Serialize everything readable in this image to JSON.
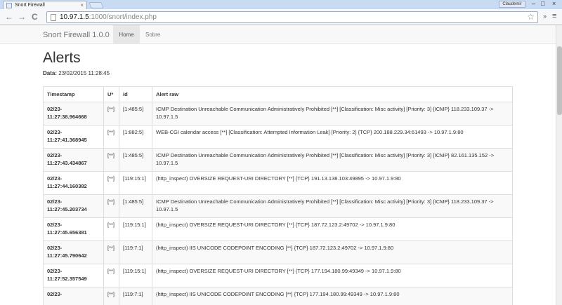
{
  "browser": {
    "tab_title": "Snort Firewall",
    "tab_close": "×",
    "user_label": "Claudemir",
    "win_minimize": "–",
    "win_maximize": "□",
    "win_close": "×",
    "url_host": "10.97.1.5",
    "url_rest": ":1000/snort/index.php",
    "back_icon": "←",
    "forward_icon": "→",
    "reload_icon": "C",
    "star_icon": "☆",
    "ext_icon": "»",
    "menu_icon": "≡"
  },
  "navbar": {
    "brand": "Snort Firewall 1.0.0",
    "links": [
      {
        "label": "Home",
        "active": true
      },
      {
        "label": "Sobre",
        "active": false
      }
    ]
  },
  "page": {
    "title": "Alerts",
    "date_label": "Data:",
    "date_value": "23/02/2015 11:28:45"
  },
  "table": {
    "headers": [
      "Timestamp",
      "U*",
      "id",
      "Alert raw"
    ],
    "rows": [
      {
        "ts_date": "02/23-",
        "ts_time": "11:27:38.964668",
        "u": "[**]",
        "id": "[1:485:5]",
        "raw": "ICMP Destination Unreachable Communication Administratively Prohibited [**] [Classification: Misc activity] [Priority: 3] {ICMP} 118.233.109.37 -> 10.97.1.5"
      },
      {
        "ts_date": "02/23-",
        "ts_time": "11:27:41.368945",
        "u": "[**]",
        "id": "[1:882:5]",
        "raw": "WEB-CGI calendar access [**] [Classification: Attempted Information Leak] [Priority: 2] {TCP} 200.188.229.34:61493 -> 10.97.1.9:80"
      },
      {
        "ts_date": "02/23-",
        "ts_time": "11:27:43.434867",
        "u": "[**]",
        "id": "[1:485:5]",
        "raw": "ICMP Destination Unreachable Communication Administratively Prohibited [**] [Classification: Misc activity] [Priority: 3] {ICMP} 82.161.135.152 -> 10.97.1.5"
      },
      {
        "ts_date": "02/23-",
        "ts_time": "11:27:44.160382",
        "u": "[**]",
        "id": "[119:15:1]",
        "raw": "(http_inspect) OVERSIZE REQUEST-URI DIRECTORY [**] {TCP} 191.13.138.103:49895 -> 10.97.1.9:80"
      },
      {
        "ts_date": "02/23-",
        "ts_time": "11:27:45.203734",
        "u": "[**]",
        "id": "[1:485:5]",
        "raw": "ICMP Destination Unreachable Communication Administratively Prohibited [**] [Classification: Misc activity] [Priority: 3] {ICMP} 118.233.109.37 -> 10.97.1.5"
      },
      {
        "ts_date": "02/23-",
        "ts_time": "11:27:45.656381",
        "u": "[**]",
        "id": "[119:15:1]",
        "raw": "(http_inspect) OVERSIZE REQUEST-URI DIRECTORY [**] {TCP} 187.72.123.2:49702 -> 10.97.1.9:80"
      },
      {
        "ts_date": "02/23-",
        "ts_time": "11:27:45.790642",
        "u": "[**]",
        "id": "[119:7:1]",
        "raw": "(http_inspect) IIS UNICODE CODEPOINT ENCODING [**] {TCP} 187.72.123.2:49702 -> 10.97.1.9:80"
      },
      {
        "ts_date": "02/23-",
        "ts_time": "11:27:52.357549",
        "u": "[**]",
        "id": "[119:15:1]",
        "raw": "(http_inspect) OVERSIZE REQUEST-URI DIRECTORY [**] {TCP} 177.194.180.99:49349 -> 10.97.1.9:80"
      },
      {
        "ts_date": "02/23-",
        "ts_time": "",
        "u": "[**]",
        "id": "[119:7:1]",
        "raw": "(http_inspect) IIS UNICODE CODEPOINT ENCODING [**] {TCP} 177.194.180.99:49349 -> 10.97.1.9:80"
      }
    ]
  }
}
